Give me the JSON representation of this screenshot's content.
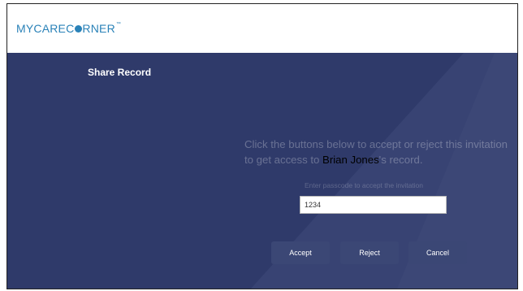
{
  "header": {
    "logo_text_a": "MYCAREC",
    "logo_text_b": "RNER",
    "logo_tm": "™"
  },
  "page": {
    "title": "Share Record"
  },
  "invitation": {
    "message_before": "Click the buttons below to accept or reject this invitation to get access to ",
    "patient_name": "Brian Jones",
    "message_after": "'s record.",
    "passcode_label": "Enter passcode to accept the invitation",
    "passcode_value": "1234"
  },
  "actions": {
    "accept_label": "Accept",
    "reject_label": "Reject",
    "cancel_label": "Cancel"
  },
  "colors": {
    "brand": "#2a82b8",
    "banner_bg": "#2f3a6a",
    "button_bg": "#3b4775"
  }
}
